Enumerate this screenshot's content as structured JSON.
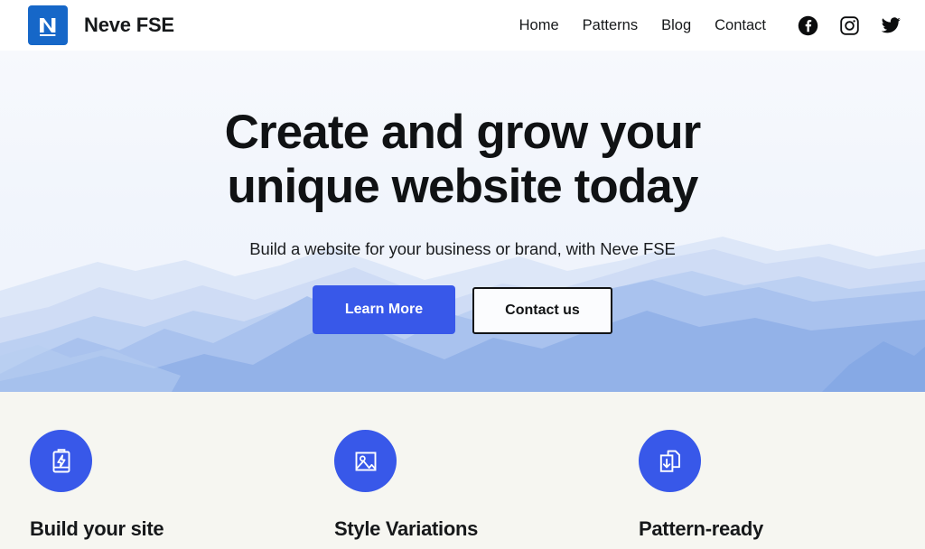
{
  "site": {
    "brand_name": "Neve FSE",
    "logo_letter": "N",
    "accent_blue": "#3858E9",
    "logo_blue": "#1667C8",
    "hero_bg": "#F1F5FC",
    "features_bg": "#F6F6F1",
    "text_color": "#16181A"
  },
  "header": {
    "nav": [
      {
        "label": "Home",
        "name": "nav-link-home"
      },
      {
        "label": "Patterns",
        "name": "nav-link-patterns"
      },
      {
        "label": "Blog",
        "name": "nav-link-blog"
      },
      {
        "label": "Contact",
        "name": "nav-link-contact"
      }
    ],
    "social": [
      {
        "icon": "facebook-icon",
        "label": "Facebook"
      },
      {
        "icon": "instagram-icon",
        "label": "Instagram"
      },
      {
        "icon": "twitter-icon",
        "label": "Twitter"
      }
    ]
  },
  "hero": {
    "title": "Create and grow your unique website today",
    "subtitle": "Build a website for your business or brand, with Neve FSE",
    "primary_button": "Learn More",
    "secondary_button": "Contact us",
    "background_illustration": "misty-blue-mountain-range"
  },
  "features": [
    {
      "title": "Build your site",
      "icon": "battery-lightning-icon"
    },
    {
      "title": "Style Variations",
      "icon": "image-photo-icon"
    },
    {
      "title": "Pattern-ready",
      "icon": "documents-download-icon"
    }
  ]
}
